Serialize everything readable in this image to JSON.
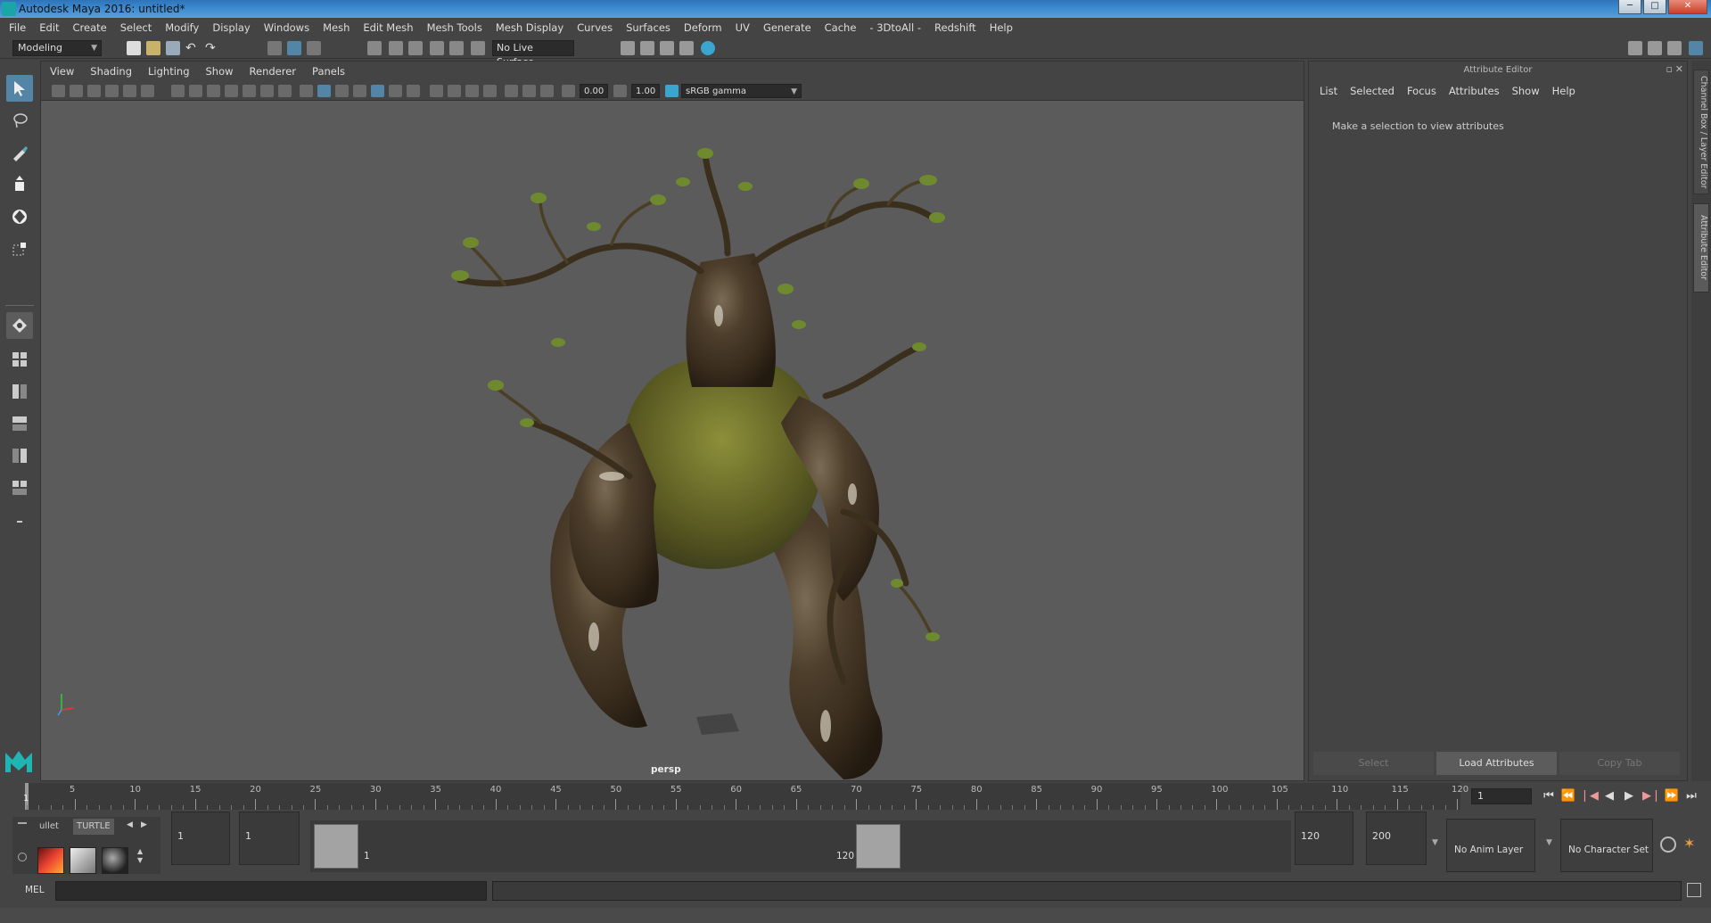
{
  "window": {
    "title": "Autodesk Maya 2016: untitled*",
    "minimize": "─",
    "maximize": "□",
    "close": "✕"
  },
  "menubar": [
    "File",
    "Edit",
    "Create",
    "Select",
    "Modify",
    "Display",
    "Windows",
    "Mesh",
    "Edit Mesh",
    "Mesh Tools",
    "Mesh Display",
    "Curves",
    "Surfaces",
    "Deform",
    "UV",
    "Generate",
    "Cache",
    "- 3DtoAll -",
    "Redshift",
    "Help"
  ],
  "status_line": {
    "mode": "Modeling",
    "live_surface": "No Live Surface"
  },
  "viewport": {
    "menu": [
      "View",
      "Shading",
      "Lighting",
      "Show",
      "Renderer",
      "Panels"
    ],
    "exposure": "0.00",
    "gamma": "1.00",
    "color_space": "sRGB gamma",
    "camera": "persp"
  },
  "attribute_editor": {
    "title": "Attribute Editor",
    "menu": [
      "List",
      "Selected",
      "Focus",
      "Attributes",
      "Show",
      "Help"
    ],
    "message": "Make a selection to view attributes",
    "buttons": {
      "select": "Select",
      "load": "Load Attributes",
      "copy": "Copy Tab"
    }
  },
  "side_tabs": {
    "channel_box": "Channel Box / Layer Editor",
    "attribute_editor": "Attribute Editor"
  },
  "timeline": {
    "ticks": [
      5,
      10,
      15,
      20,
      25,
      30,
      35,
      40,
      45,
      50,
      55,
      60,
      65,
      70,
      75,
      80,
      85,
      90,
      95,
      100,
      105,
      110,
      115,
      120
    ],
    "min_frame": 1,
    "max_frame": 120,
    "current_frame_label": "1",
    "current_frame_field": "1"
  },
  "range": {
    "start": "1",
    "playback_start": "1",
    "range_start_label": "1",
    "range_end_label": "120",
    "playback_end": "120",
    "end": "200",
    "anim_layer": "No Anim Layer",
    "character_set": "No Character Set"
  },
  "shelf": {
    "tabs": [
      "ullet",
      "TURTLE"
    ]
  },
  "command_line": {
    "label": "MEL"
  }
}
